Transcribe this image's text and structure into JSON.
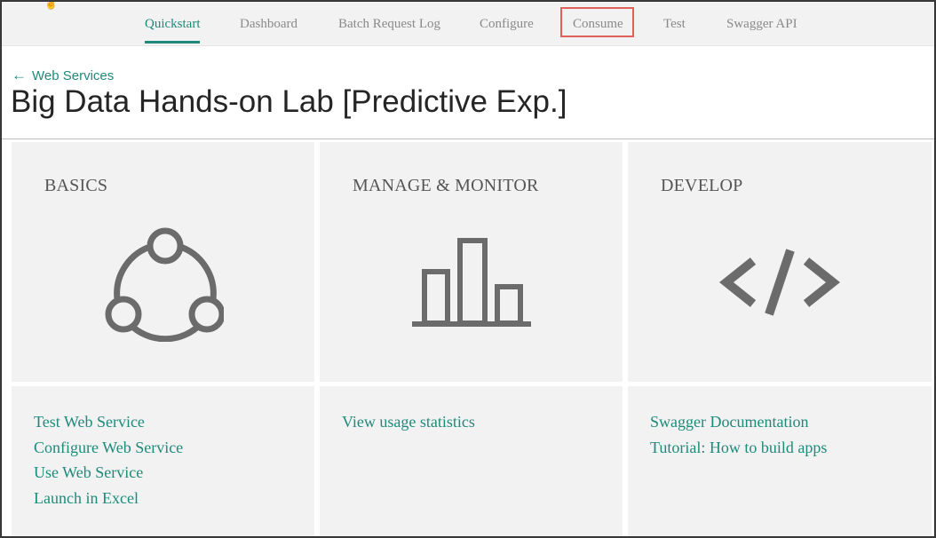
{
  "nav": {
    "items": [
      {
        "label": "Quickstart",
        "active": true
      },
      {
        "label": "Dashboard"
      },
      {
        "label": "Batch Request Log"
      },
      {
        "label": "Configure"
      },
      {
        "label": "Consume",
        "highlighted": true
      },
      {
        "label": "Test"
      },
      {
        "label": "Swagger API"
      }
    ]
  },
  "breadcrumb": {
    "back_label": "Web Services",
    "arrow": "←"
  },
  "page": {
    "title": "Big Data Hands-on Lab [Predictive Exp.]"
  },
  "sections": [
    {
      "title": "BASICS",
      "icon": "share-icon",
      "links": [
        "Test Web Service",
        "Configure Web Service",
        "Use Web Service",
        "Launch in Excel"
      ]
    },
    {
      "title": "MANAGE & MONITOR",
      "icon": "bar-chart-icon",
      "links": [
        "View usage statistics"
      ]
    },
    {
      "title": "DEVELOP",
      "icon": "code-icon",
      "links": [
        "Swagger Documentation",
        "Tutorial: How to build apps"
      ]
    }
  ],
  "colors": {
    "accent": "#1f8a7a",
    "highlight": "#e0605a",
    "tile": "#f2f2f2",
    "icon": "#6b6b6b"
  }
}
